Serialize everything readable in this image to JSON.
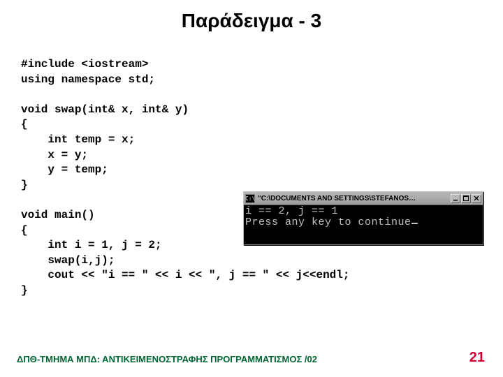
{
  "title": "Παράδειγμα - 3",
  "code": "#include <iostream>\nusing namespace std;\n\nvoid swap(int& x, int& y)\n{\n    int temp = x;\n    x = y;\n    y = temp;\n}\n\nvoid main()\n{\n    int i = 1, j = 2;\n    swap(i,j);\n    cout << \"i == \" << i << \", j == \" << j<<endl;\n}",
  "console": {
    "icon_text": "C:\\",
    "title": "\"C:\\DOCUMENTS AND SETTINGS\\STEFANOS…",
    "output_line1": "i == 2, j == 1",
    "output_line2": "Press any key to continue"
  },
  "footer": "ΔΠΘ-ΤΜΗΜΑ ΜΠΔ: ΑΝΤΙΚΕΙΜΕΝΟΣΤΡΑΦΗΣ ΠΡΟΓΡΑΜΜΑΤΙΣΜΟΣ /02",
  "page_number": "21"
}
